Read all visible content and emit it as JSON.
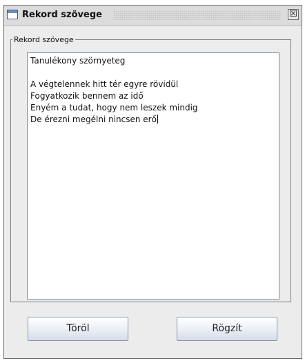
{
  "window": {
    "title": "Rekord szövege",
    "close_glyph": "☒",
    "icon": "window-icon"
  },
  "group": {
    "label": "Rekord szövege"
  },
  "editor": {
    "lines": [
      "Tanulékony szörnyeteg",
      "",
      "A végtelennek hitt tér egyre rövidül",
      "Fogyatkozik bennem az idő",
      "Enyém a tudat, hogy nem leszek mindig",
      "De érezni megélni nincsen erő"
    ]
  },
  "buttons": {
    "delete_label": "Töröl",
    "save_label": "Rögzít"
  }
}
